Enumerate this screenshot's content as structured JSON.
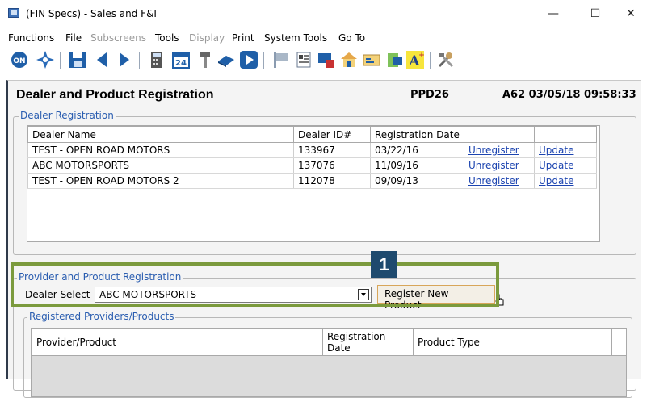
{
  "window": {
    "title": "(FIN Specs) - Sales and F&I",
    "minimize_glyph": "—",
    "maximize_glyph": "☐",
    "close_glyph": "✕"
  },
  "menu": {
    "items": [
      "Functions",
      "File",
      "Subscreens",
      "Tools",
      "Display",
      "Print",
      "System Tools",
      "Go To"
    ]
  },
  "header": {
    "title": "Dealer and Product Registration",
    "screen_code": "PPD26",
    "datetime": "A62  03/05/18 09:58:33"
  },
  "dealer_registration": {
    "label": "Dealer Registration",
    "columns": [
      "Dealer Name",
      "Dealer ID#",
      "Registration Date",
      "",
      ""
    ],
    "rows": [
      {
        "name": "TEST - OPEN ROAD MOTORS",
        "id": "133967",
        "date": "03/22/16",
        "unregister": "Unregister",
        "update": "Update"
      },
      {
        "name": "ABC MOTORSPORTS",
        "id": "137076",
        "date": "11/09/16",
        "unregister": "Unregister",
        "update": "Update"
      },
      {
        "name": "TEST - OPEN ROAD MOTORS 2",
        "id": "112078",
        "date": "09/09/13",
        "unregister": "Unregister",
        "update": "Update"
      }
    ]
  },
  "provider_registration": {
    "label": "Provider and Product Registration",
    "dealer_select_label": "Dealer Select",
    "dealer_select_value": "ABC MOTORSPORTS",
    "register_button": "Register New Product"
  },
  "registered_products": {
    "label": "Registered Providers/Products",
    "columns": [
      "Provider/Product",
      "Registration Date",
      "Product Type"
    ]
  },
  "callout": {
    "step_number": "1"
  },
  "colors": {
    "highlight": "#7b9a3d",
    "badge": "#1e4a6e",
    "link": "#1c44b0",
    "group_label": "#2a5db0"
  }
}
